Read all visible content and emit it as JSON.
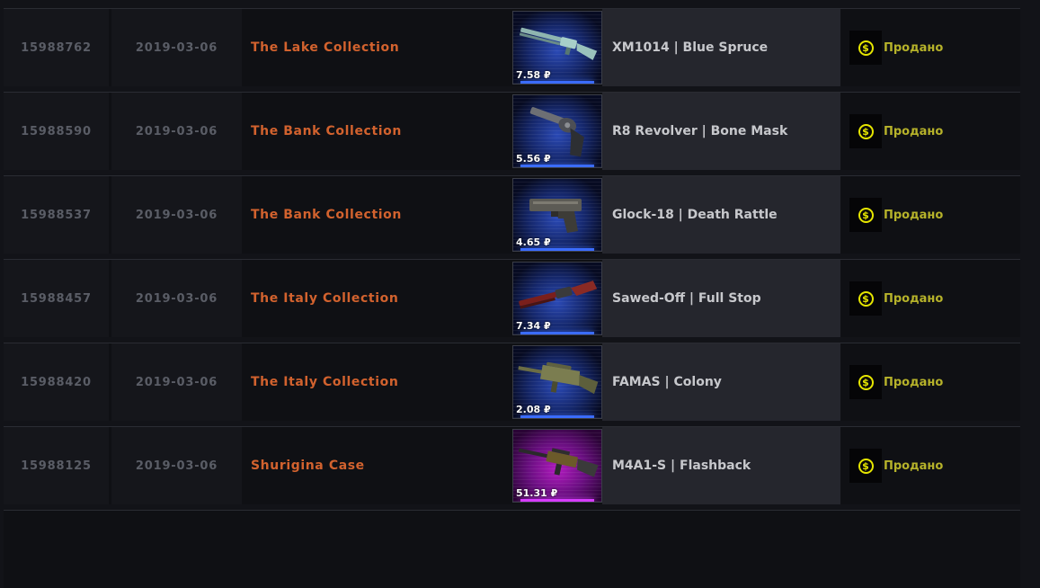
{
  "colors": {
    "collection_text": "#d2622e",
    "status_text": "#b6b22a",
    "coin": "#e6e600",
    "rarity_blue": "#2a49b5",
    "rarity_purple": "#b21bbf"
  },
  "rows": [
    {
      "id": "15988762",
      "date": "2019-03-06",
      "collection": "The Lake Collection",
      "item": "XM1014 | Blue Spruce",
      "price": "7.58 ₽",
      "rarity": "blue",
      "weapon_icon": "shotgun-icon",
      "status_icon": "dollar-coin-icon",
      "status": "Продано"
    },
    {
      "id": "15988590",
      "date": "2019-03-06",
      "collection": "The Bank Collection",
      "item": "R8 Revolver | Bone Mask",
      "price": "5.56 ₽",
      "rarity": "blue",
      "weapon_icon": "revolver-icon",
      "status_icon": "dollar-coin-icon",
      "status": "Продано"
    },
    {
      "id": "15988537",
      "date": "2019-03-06",
      "collection": "The Bank Collection",
      "item": "Glock-18 | Death Rattle",
      "price": "4.65 ₽",
      "rarity": "blue",
      "weapon_icon": "pistol-icon",
      "status_icon": "dollar-coin-icon",
      "status": "Продано"
    },
    {
      "id": "15988457",
      "date": "2019-03-06",
      "collection": "The Italy Collection",
      "item": "Sawed-Off | Full Stop",
      "price": "7.34 ₽",
      "rarity": "blue",
      "weapon_icon": "shotgun-icon",
      "status_icon": "dollar-coin-icon",
      "status": "Продано"
    },
    {
      "id": "15988420",
      "date": "2019-03-06",
      "collection": "The Italy Collection",
      "item": "FAMAS | Colony",
      "price": "2.08 ₽",
      "rarity": "blue",
      "weapon_icon": "rifle-icon",
      "status_icon": "dollar-coin-icon",
      "status": "Продано"
    },
    {
      "id": "15988125",
      "date": "2019-03-06",
      "collection": "Shurigina Case",
      "item": "M4A1-S | Flashback",
      "price": "51.31 ₽",
      "rarity": "purple",
      "weapon_icon": "rifle-icon",
      "status_icon": "dollar-coin-icon",
      "status": "Продано"
    }
  ]
}
